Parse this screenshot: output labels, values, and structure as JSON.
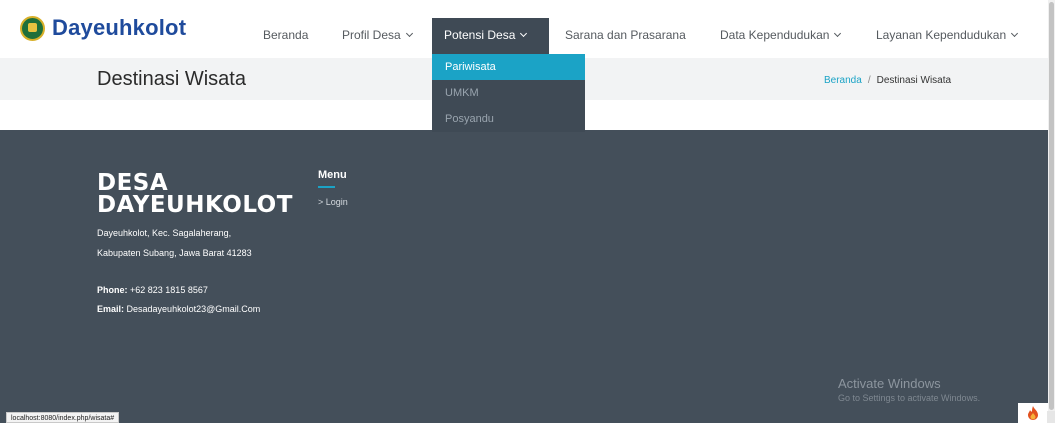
{
  "header": {
    "site_name": "Dayeuhkolot",
    "nav": [
      {
        "label": "Beranda",
        "has_dropdown": false
      },
      {
        "label": "Profil Desa",
        "has_dropdown": true
      },
      {
        "label": "Potensi Desa",
        "has_dropdown": true,
        "active": true
      },
      {
        "label": "Sarana dan Prasarana",
        "has_dropdown": false
      },
      {
        "label": "Data Kependudukan",
        "has_dropdown": true
      },
      {
        "label": "Layanan Kependudukan",
        "has_dropdown": true
      }
    ],
    "dropdown": [
      "Pariwisata",
      "UMKM",
      "Posyandu"
    ]
  },
  "page": {
    "title": "Destinasi Wisata",
    "breadcrumb": {
      "home": "Beranda",
      "separator": "/",
      "current": "Destinasi Wisata"
    }
  },
  "footer": {
    "brand_line1": "DESA",
    "brand_line2": "DAYEUHKOLOT",
    "address_line1": "Dayeuhkolot, Kec. Sagalaherang,",
    "address_line2": "Kabupaten Subang, Jawa Barat 41283",
    "phone_label": "Phone:",
    "phone": "+62 823 1815 8567",
    "email_label": "Email:",
    "email": "Desadayeuhkolot23@Gmail.Com",
    "menu_title": "Menu",
    "menu_links": [
      "Login"
    ]
  },
  "overlay": {
    "activate_title": "Activate Windows",
    "activate_sub": "Go to Settings to activate Windows."
  },
  "status_url": "localhost:8080/index.php/wisata#",
  "colors": {
    "accent": "#1ba3c6",
    "brand": "#1f4b9c",
    "footer_bg": "#444f5a",
    "nav_active": "#3f4a55"
  }
}
